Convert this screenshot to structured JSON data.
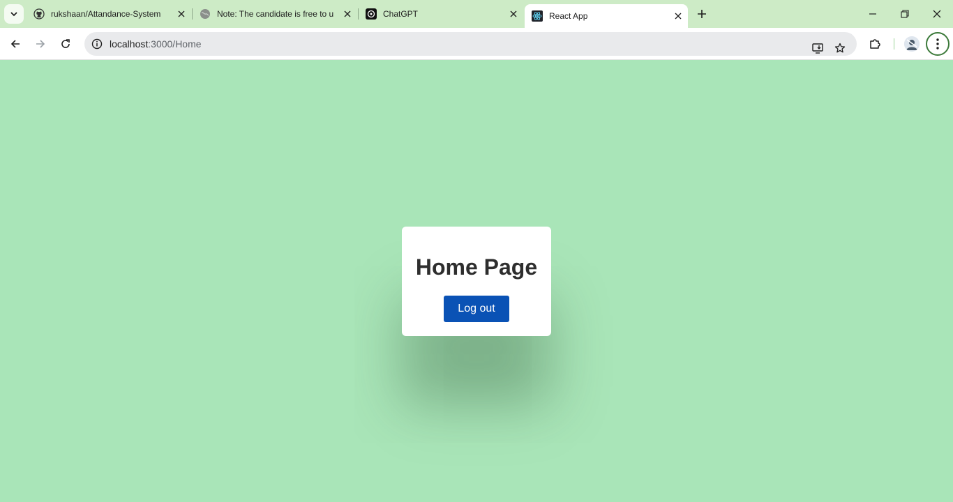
{
  "browser": {
    "tabs": [
      {
        "title": "rukshaan/Attandance-System",
        "favicon": "github-icon",
        "active": false
      },
      {
        "title": "Note: The candidate is free to u",
        "favicon": "globe-icon",
        "active": false
      },
      {
        "title": "ChatGPT",
        "favicon": "chatgpt-icon",
        "active": false
      },
      {
        "title": "React App",
        "favicon": "react-icon",
        "active": true
      }
    ],
    "address": {
      "host": "localhost",
      "path": ":3000/Home"
    }
  },
  "page": {
    "heading": "Home Page",
    "logout_label": "Log out"
  },
  "colors": {
    "page_background": "#a9e5b8",
    "button": "#0a52b5",
    "tabstrip": "#cdebc6"
  }
}
